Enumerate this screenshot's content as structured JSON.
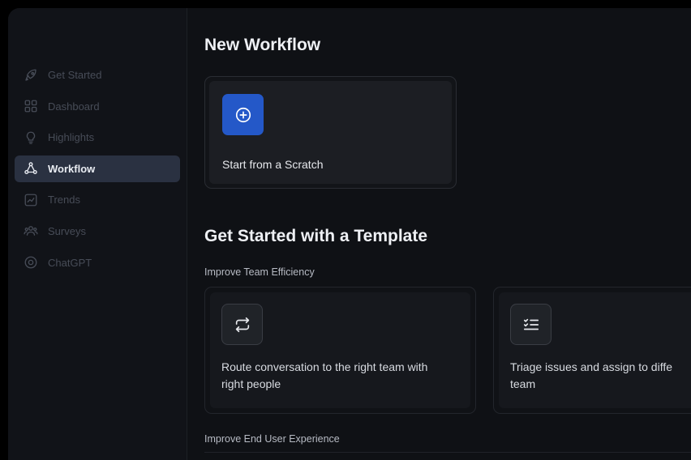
{
  "sidebar": {
    "items": [
      {
        "label": "Get Started",
        "icon": "rocket-icon",
        "active": false
      },
      {
        "label": "Dashboard",
        "icon": "grid-icon",
        "active": false
      },
      {
        "label": "Highlights",
        "icon": "lightbulb-icon",
        "active": false
      },
      {
        "label": "Workflow",
        "icon": "workflow-icon",
        "active": true
      },
      {
        "label": "Trends",
        "icon": "trend-chart-icon",
        "active": false
      },
      {
        "label": "Surveys",
        "icon": "users-icon",
        "active": false
      },
      {
        "label": "ChatGPT",
        "icon": "ai-icon",
        "active": false
      }
    ]
  },
  "main": {
    "new_workflow_title": "New Workflow",
    "scratch_card": {
      "label": "Start from a Scratch",
      "icon": "plus-circle-icon"
    },
    "template_title": "Get Started with a Template",
    "sections": [
      {
        "label": "Improve Team Efficiency",
        "templates": [
          {
            "icon": "repeat-arrows-icon",
            "line1": "Route conversation to the right team with",
            "line2": "right people"
          },
          {
            "icon": "checklist-icon",
            "line1": "Triage issues and assign to diffe",
            "line2": "team"
          }
        ]
      },
      {
        "label": "Improve End User Experience"
      }
    ]
  },
  "colors": {
    "accent": "#2458c8",
    "active_nav_bg": "#2a3141",
    "background": "#0f1115"
  }
}
